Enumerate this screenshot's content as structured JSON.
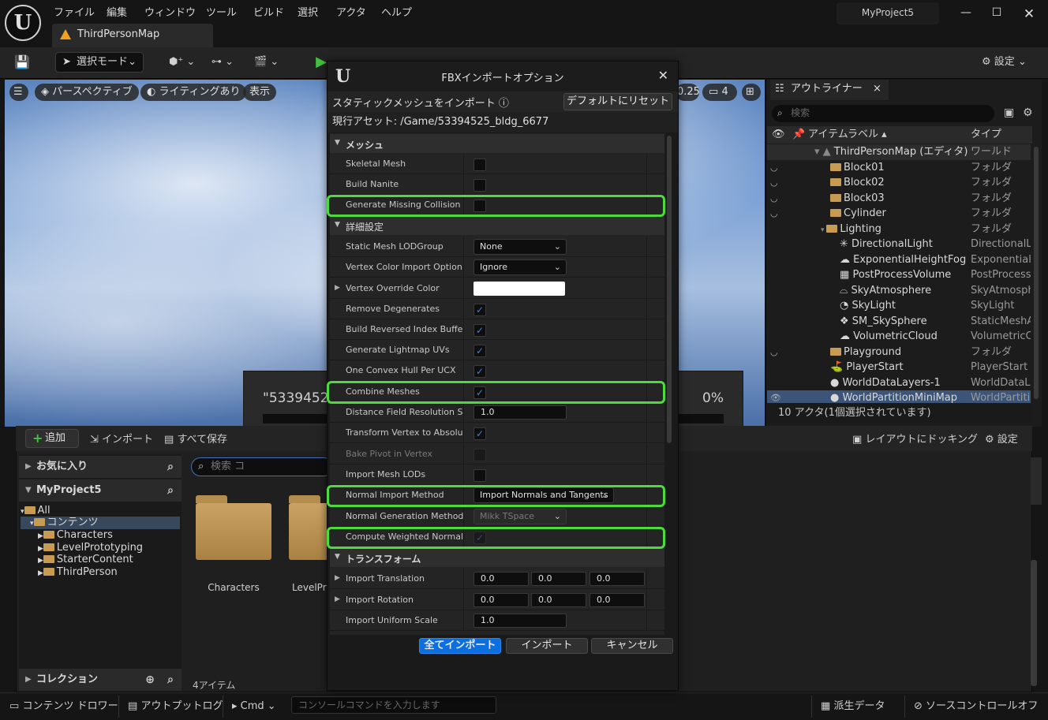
{
  "menu": [
    "ファイル",
    "編集",
    "ウィンドウ",
    "ツール",
    "ビルド",
    "選択",
    "アクタ",
    "ヘルプ"
  ],
  "project_name": "MyProject5",
  "map_tab": "ThirdPersonMap",
  "toolbar": {
    "mode": "選択モード",
    "settings": "設定"
  },
  "viewport": {
    "perspective": "パースペクティブ",
    "lighting": "ライティングあり",
    "show": "表示",
    "speed": "0.25",
    "cam": "4"
  },
  "progress": {
    "text": "\"5339452",
    "pct": "0%"
  },
  "outliner": {
    "tab": "アウトライナー",
    "search_placeholder": "検索",
    "col_label": "アイテムラベル ▴",
    "col_type": "タイプ",
    "rows": [
      {
        "label": "ThirdPersonMap (エディタ)",
        "type": "ワールド"
      },
      {
        "label": "Block01",
        "type": "フォルダ"
      },
      {
        "label": "Block02",
        "type": "フォルダ"
      },
      {
        "label": "Block03",
        "type": "フォルダ"
      },
      {
        "label": "Cylinder",
        "type": "フォルダ"
      },
      {
        "label": "Lighting",
        "type": "フォルダ"
      },
      {
        "label": "DirectionalLight",
        "type": "DirectionalLig"
      },
      {
        "label": "ExponentialHeightFog",
        "type": "ExponentialH"
      },
      {
        "label": "PostProcessVolume",
        "type": "PostProcessV"
      },
      {
        "label": "SkyAtmosphere",
        "type": "SkyAtmosphe"
      },
      {
        "label": "SkyLight",
        "type": "SkyLight"
      },
      {
        "label": "SM_SkySphere",
        "type": "StaticMeshAc"
      },
      {
        "label": "VolumetricCloud",
        "type": "VolumetricClo"
      },
      {
        "label": "Playground",
        "type": "フォルダ"
      },
      {
        "label": "PlayerStart",
        "type": "PlayerStart"
      },
      {
        "label": "WorldDataLayers-1",
        "type": "WorldDataLay"
      },
      {
        "label": "WorldPartitionMiniMap",
        "type": "WorldPartitio"
      }
    ],
    "footer": "10 アクタ(1個選択されています)"
  },
  "content_browser": {
    "add": "追加",
    "import": "インポート",
    "save_all": "すべて保存",
    "dock": "レイアウトにドッキング",
    "settings": "設定",
    "favorites": "お気に入り",
    "project": "MyProject5",
    "tree": [
      "All",
      "コンテンツ",
      "Characters",
      "LevelPrototyping",
      "StarterContent",
      "ThirdPerson"
    ],
    "search_placeholder": "検索 コ",
    "folders": [
      "Characters",
      "LevelPro"
    ],
    "collections": "コレクション",
    "items_count": "4アイテム"
  },
  "statusbar": {
    "drawer": "コンテンツ ドロワー",
    "output": "アウトプットログ",
    "cmd": "Cmd",
    "console_placeholder": "コンソールコマンドを入力します",
    "derived": "派生データ",
    "source_control": "ソースコントロールオフ"
  },
  "dialog": {
    "title": "FBXインポートオプション",
    "subtitle": "スタティックメッシュをインポート",
    "reset": "デフォルトにリセット",
    "asset_label": "現行アセット:",
    "asset_path": "/Game/53394525_bldg_6677",
    "cat_mesh": "メッシュ",
    "cat_advanced": "詳細設定",
    "cat_transform": "トランスフォーム",
    "props": {
      "skeletal_mesh": "Skeletal Mesh",
      "build_nanite": "Build Nanite",
      "gen_missing_collision": "Generate Missing Collision",
      "lod_group": "Static Mesh LODGroup",
      "lod_group_val": "None",
      "vcolor_import": "Vertex Color Import Option",
      "vcolor_import_val": "Ignore",
      "vcolor_override": "Vertex Override Color",
      "remove_degen": "Remove Degenerates",
      "build_reversed": "Build Reversed Index Buffer",
      "gen_lightmap": "Generate Lightmap UVs",
      "one_convex": "One Convex Hull Per UCX",
      "combine_meshes": "Combine Meshes",
      "dist_field": "Distance Field Resolution Sc...",
      "dist_field_val": "1.0",
      "transform_vertex": "Transform Vertex to Absolute",
      "bake_pivot": "Bake Pivot in Vertex",
      "import_lods": "Import Mesh LODs",
      "normal_import": "Normal Import Method",
      "normal_import_val": "Import Normals and Tangents",
      "normal_gen": "Normal Generation Method",
      "normal_gen_val": "Mikk TSpace",
      "weighted_normals": "Compute Weighted Normals",
      "import_translation": "Import Translation",
      "import_rotation": "Import Rotation",
      "import_scale": "Import Uniform Scale",
      "zero": "0.0",
      "one": "1.0"
    },
    "btn_import_all": "全てインポート",
    "btn_import": "インポート",
    "btn_cancel": "キャンセル"
  },
  "colors": {
    "accent": "#0b6fe0",
    "highlight": "#4ddb3c",
    "check": "#3d82e6"
  }
}
